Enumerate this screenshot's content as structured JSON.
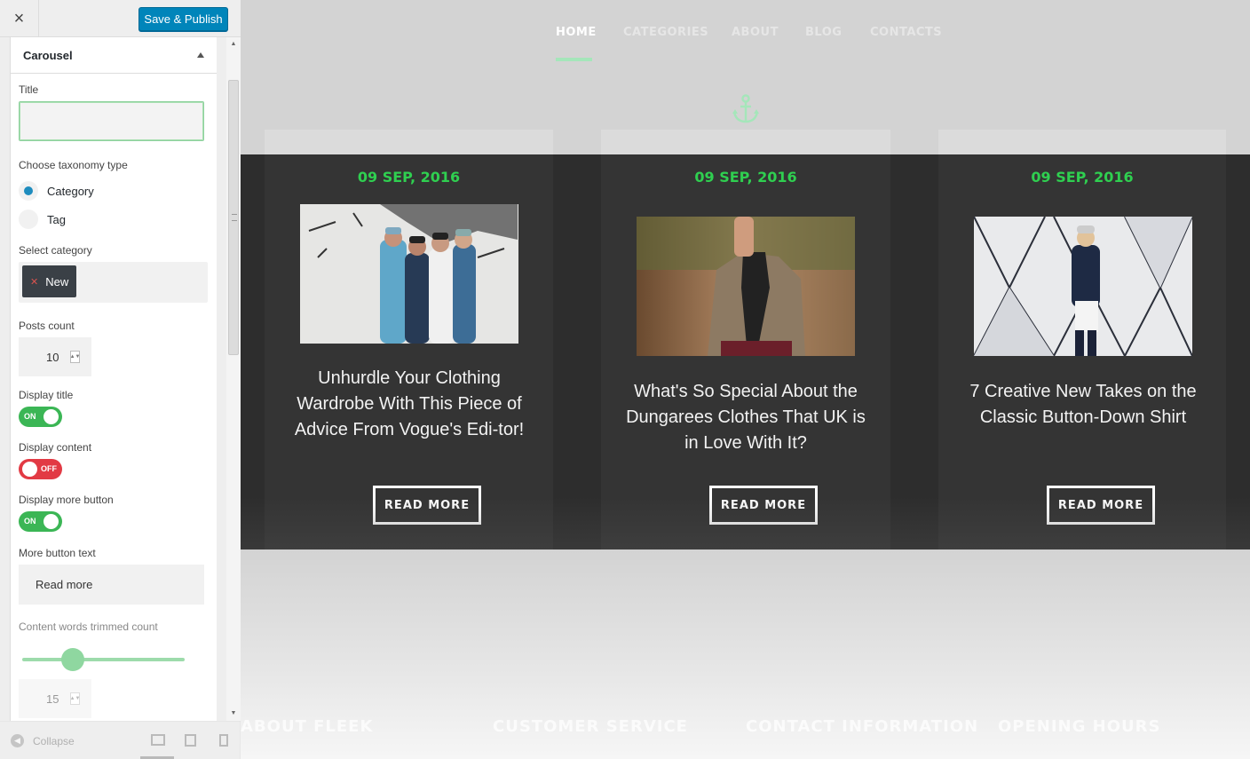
{
  "topbar": {
    "close_icon": "×",
    "save_label": "Save & Publish"
  },
  "section": {
    "title": "Carousel"
  },
  "fields": {
    "title_label": "Title",
    "title_value": "",
    "taxonomy_label": "Choose taxonomy type",
    "taxonomy_options": [
      "Category",
      "Tag"
    ],
    "taxonomy_selected": "Category",
    "category_label": "Select category",
    "category_chip": "New",
    "posts_count_label": "Posts count",
    "posts_count": "10",
    "display_title_label": "Display title",
    "display_title": "ON",
    "display_content_label": "Display content",
    "display_content": "OFF",
    "display_more_label": "Display more button",
    "display_more": "ON",
    "more_text_label": "More button text",
    "more_text_value": "Read more",
    "trim_label": "Content words trimmed count",
    "trim_value": "15"
  },
  "footer": {
    "collapse_label": "Collapse"
  },
  "preview": {
    "nav": [
      "HOME",
      "CATEGORIES",
      "ABOUT",
      "BLOG",
      "CONTACTS"
    ],
    "nav_active": "HOME",
    "cards": [
      {
        "date": "09 SEP, 2016",
        "title": "Unhurdle Your Clothing Wardrobe With This Piece of Advice From Vogue's Edi-tor!",
        "button": "READ MORE"
      },
      {
        "date": "09 SEP, 2016",
        "title": "What's So Special About the Dungarees Clothes That UK is in Love With It?",
        "button": "READ MORE"
      },
      {
        "date": "09 SEP, 2016",
        "title": "7 Creative New Takes on the Classic Button-Down Shirt",
        "button": "READ MORE"
      }
    ],
    "footer_headings": [
      "ABOUT FLEEK",
      "CUSTOMER SERVICE",
      "CONTACT INFORMATION",
      "OPENING HOURS"
    ]
  },
  "colors": {
    "accent_green": "#2fcf50",
    "primary_blue": "#0085ba",
    "toggle_on": "#3bb655",
    "toggle_off": "#e23a44"
  }
}
